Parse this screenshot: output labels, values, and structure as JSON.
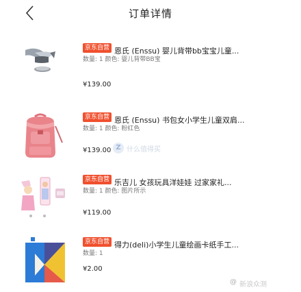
{
  "header": {
    "title": "订单详情",
    "back_icon": "chevron-left-icon"
  },
  "orders": [
    {
      "tag": "京东自营",
      "name": "恩氏 (Enssu) 婴儿背带bb宝宝儿童...",
      "spec": "数量: 1  颜色: 婴儿背带BB宝",
      "price": "¥139.00",
      "image": "baby-carrier-image"
    },
    {
      "tag": "京东自营",
      "name": "恩氏 (Enssu) 书包女小学生儿童双肩...",
      "spec": "数量: 1  颜色: 粉红色",
      "price": "¥139.00",
      "image": "pink-backpack-image"
    },
    {
      "tag": "京东自营",
      "name": "乐吉儿 女孩玩具洋娃娃 过家家礼...",
      "spec": "数量: 1  颜色: 图片所示",
      "price": "¥119.00",
      "image": "doll-toy-image"
    },
    {
      "tag": "京东自营",
      "name": "得力(deli)小学生儿童绘画卡纸手工...",
      "spec": "数量: 1",
      "price": "¥2.00",
      "image": "craft-paper-image"
    }
  ],
  "watermarks": {
    "mid_badge": "Z",
    "mid_text": "什么值得买",
    "bottom_at": "@",
    "bottom_text": "新浪众测"
  },
  "colors": {
    "tag_bg": "#f0502e",
    "text": "#222222",
    "spec": "#7a7a7a"
  }
}
